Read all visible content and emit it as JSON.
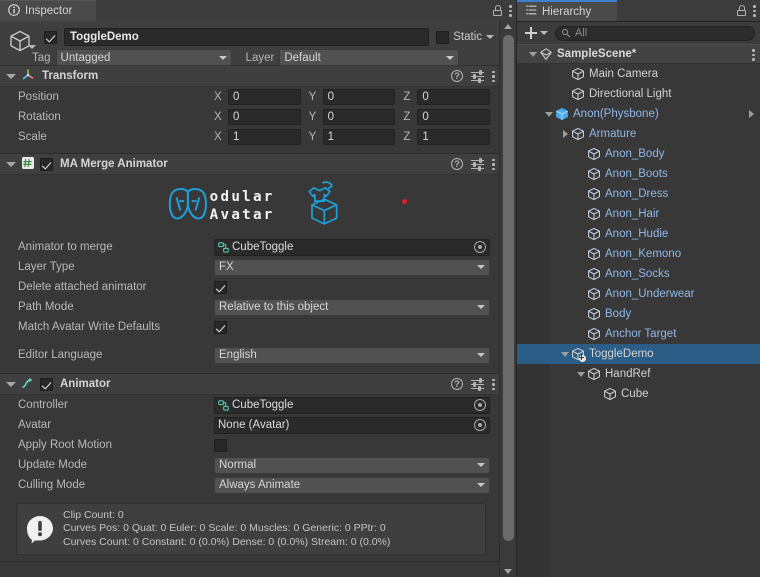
{
  "inspector": {
    "tab_label": "Inspector",
    "tab_icon": "info-icon",
    "lock_icon": "lock-icon",
    "menu_icon": "kebab-menu-icon",
    "object_icon": "gameobject-cube-icon",
    "object_name": "ToggleDemo",
    "object_enabled": true,
    "static_label": "Static",
    "tag_label": "Tag",
    "tag_value": "Untagged",
    "layer_label": "Layer",
    "layer_value": "Default",
    "components": [
      {
        "title": "Transform",
        "icon": "transform-axis-icon",
        "help_icon": "help-icon",
        "preset_icon": "preset-sliders-icon",
        "menu_icon": "kebab-menu-icon",
        "rows": [
          {
            "label": "Position",
            "x": "0",
            "y": "0",
            "z": "0"
          },
          {
            "label": "Rotation",
            "x": "0",
            "y": "0",
            "z": "0"
          },
          {
            "label": "Scale",
            "x": "1",
            "y": "1",
            "z": "1"
          }
        ],
        "axes": [
          "X",
          "Y",
          "Z"
        ]
      },
      {
        "title": "MA Merge Animator",
        "icon": "csharp-script-icon",
        "enabled": true,
        "banner_logo": "modular-avatar-logo",
        "fields": [
          {
            "label": "Animator to merge",
            "type": "object",
            "value": "CubeToggle",
            "value_icon": "animator-controller-icon"
          },
          {
            "label": "Layer Type",
            "type": "dropdown",
            "value": "FX"
          },
          {
            "label": "Delete attached animator",
            "type": "checkbox",
            "value": true
          },
          {
            "label": "Path Mode",
            "type": "dropdown",
            "value": "Relative to this object"
          },
          {
            "label": "Match Avatar Write Defaults",
            "type": "checkbox",
            "value": true
          },
          {
            "label": "Editor Language",
            "type": "dropdown",
            "value": "English"
          }
        ]
      },
      {
        "title": "Animator",
        "icon": "animator-icon",
        "enabled": true,
        "fields": [
          {
            "label": "Controller",
            "type": "object",
            "value": "CubeToggle",
            "value_icon": "animator-controller-icon"
          },
          {
            "label": "Avatar",
            "type": "object",
            "value": "None (Avatar)",
            "value_icon": ""
          },
          {
            "label": "Apply Root Motion",
            "type": "checkbox",
            "value": false
          },
          {
            "label": "Update Mode",
            "type": "dropdown",
            "value": "Normal"
          },
          {
            "label": "Culling Mode",
            "type": "dropdown",
            "value": "Always Animate"
          }
        ],
        "helpbox": {
          "icon": "warning-icon",
          "lines": "Clip Count: 0\nCurves Pos: 0 Quat: 0 Euler: 0 Scale: 0 Muscles: 0 Generic: 0 PPtr: 0\nCurves Count: 0 Constant: 0 (0.0%) Dense: 0 (0.0%) Stream: 0 (0.0%)"
        }
      }
    ],
    "scrollbar": {
      "up_icon": "scroll-up-arrow",
      "down_icon": "scroll-down-arrow"
    }
  },
  "hierarchy": {
    "tab_label": "Hierarchy",
    "tab_icon": "hierarchy-icon",
    "lock_icon": "lock-icon",
    "menu_icon": "kebab-menu-icon",
    "create_label": "+",
    "create_dropdown_icon": "chevron-down-icon",
    "search_placeholder": "All",
    "search_value": "",
    "search_icon": "search-icon",
    "rows": [
      {
        "label": "SampleScene*",
        "depth": 0,
        "icon": "scene-icon",
        "twisty": "down",
        "color": "bold",
        "scene": true,
        "selected": false,
        "menu": true
      },
      {
        "label": "Main Camera",
        "depth": 2,
        "icon": "gameobject-icon",
        "twisty": "",
        "color": "white",
        "selected": false
      },
      {
        "label": "Directional Light",
        "depth": 2,
        "icon": "gameobject-icon",
        "twisty": "",
        "color": "white",
        "selected": false
      },
      {
        "label": "Anon(Physbone)",
        "depth": 1,
        "icon": "prefab-icon",
        "twisty": "down",
        "color": "blue",
        "selected": false,
        "chevron": true
      },
      {
        "label": "Armature",
        "depth": 2,
        "icon": "gameobject-icon",
        "twisty": "right",
        "color": "blue",
        "selected": false
      },
      {
        "label": "Anon_Body",
        "depth": 3,
        "icon": "gameobject-icon",
        "twisty": "",
        "color": "blue",
        "selected": false
      },
      {
        "label": "Anon_Boots",
        "depth": 3,
        "icon": "gameobject-icon",
        "twisty": "",
        "color": "blue",
        "selected": false
      },
      {
        "label": "Anon_Dress",
        "depth": 3,
        "icon": "gameobject-icon",
        "twisty": "",
        "color": "blue",
        "selected": false
      },
      {
        "label": "Anon_Hair",
        "depth": 3,
        "icon": "gameobject-icon",
        "twisty": "",
        "color": "blue",
        "selected": false
      },
      {
        "label": "Anon_Hudie",
        "depth": 3,
        "icon": "gameobject-icon",
        "twisty": "",
        "color": "blue",
        "selected": false
      },
      {
        "label": "Anon_Kemono",
        "depth": 3,
        "icon": "gameobject-icon",
        "twisty": "",
        "color": "blue",
        "selected": false
      },
      {
        "label": "Anon_Socks",
        "depth": 3,
        "icon": "gameobject-icon",
        "twisty": "",
        "color": "blue",
        "selected": false
      },
      {
        "label": "Anon_Underwear",
        "depth": 3,
        "icon": "gameobject-icon",
        "twisty": "",
        "color": "blue",
        "selected": false
      },
      {
        "label": "Body",
        "depth": 3,
        "icon": "gameobject-icon",
        "twisty": "",
        "color": "blue",
        "selected": false
      },
      {
        "label": "Anchor Target",
        "depth": 3,
        "icon": "gameobject-icon",
        "twisty": "",
        "color": "blue",
        "selected": false
      },
      {
        "label": "ToggleDemo",
        "depth": 2,
        "icon": "gameobject-badge-icon",
        "twisty": "down",
        "color": "white",
        "selected": true
      },
      {
        "label": "HandRef",
        "depth": 3,
        "icon": "gameobject-icon",
        "twisty": "down",
        "color": "white",
        "selected": false
      },
      {
        "label": "Cube",
        "depth": 4,
        "icon": "gameobject-icon",
        "twisty": "",
        "color": "white",
        "selected": false
      }
    ]
  }
}
